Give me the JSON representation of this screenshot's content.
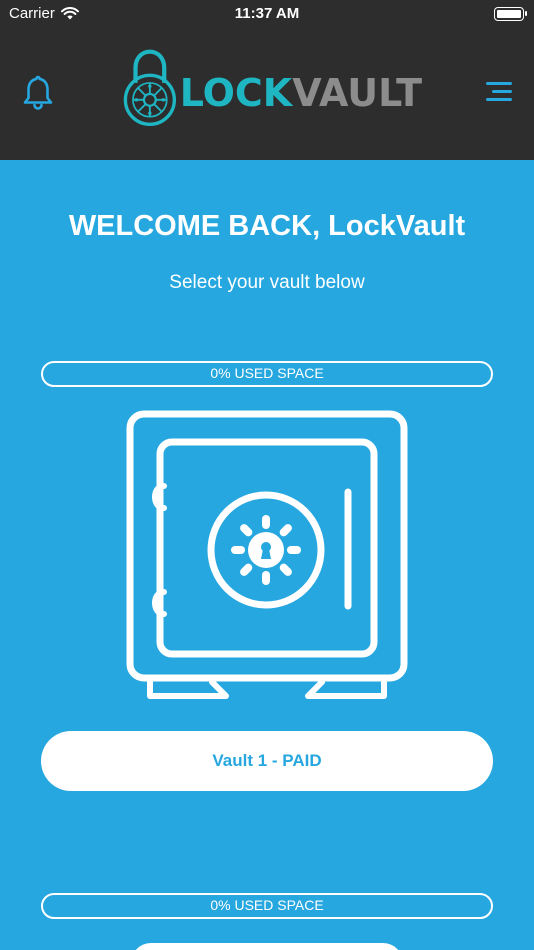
{
  "status_bar": {
    "carrier": "Carrier",
    "time": "11:37 AM",
    "battery_level": 1.0
  },
  "header": {
    "logo_lock": "LOCK",
    "logo_vault": "VAULT",
    "bell_icon": "bell-icon",
    "menu_icon": "hamburger-menu-icon"
  },
  "main": {
    "welcome": "WELCOME BACK, LockVault",
    "subtitle": "Select your vault below",
    "vaults": [
      {
        "usage_label": "0% USED SPACE",
        "usage_percent": 0,
        "button_label": "Vault 1 - PAID",
        "icon": "safe-icon"
      },
      {
        "usage_label": "0% USED SPACE",
        "usage_percent": 0,
        "button_label": "",
        "icon": "safe-icon"
      }
    ]
  },
  "colors": {
    "background": "#26a7df",
    "header": "#2d2d2d",
    "accent": "#1fb6c3",
    "white": "#ffffff"
  }
}
